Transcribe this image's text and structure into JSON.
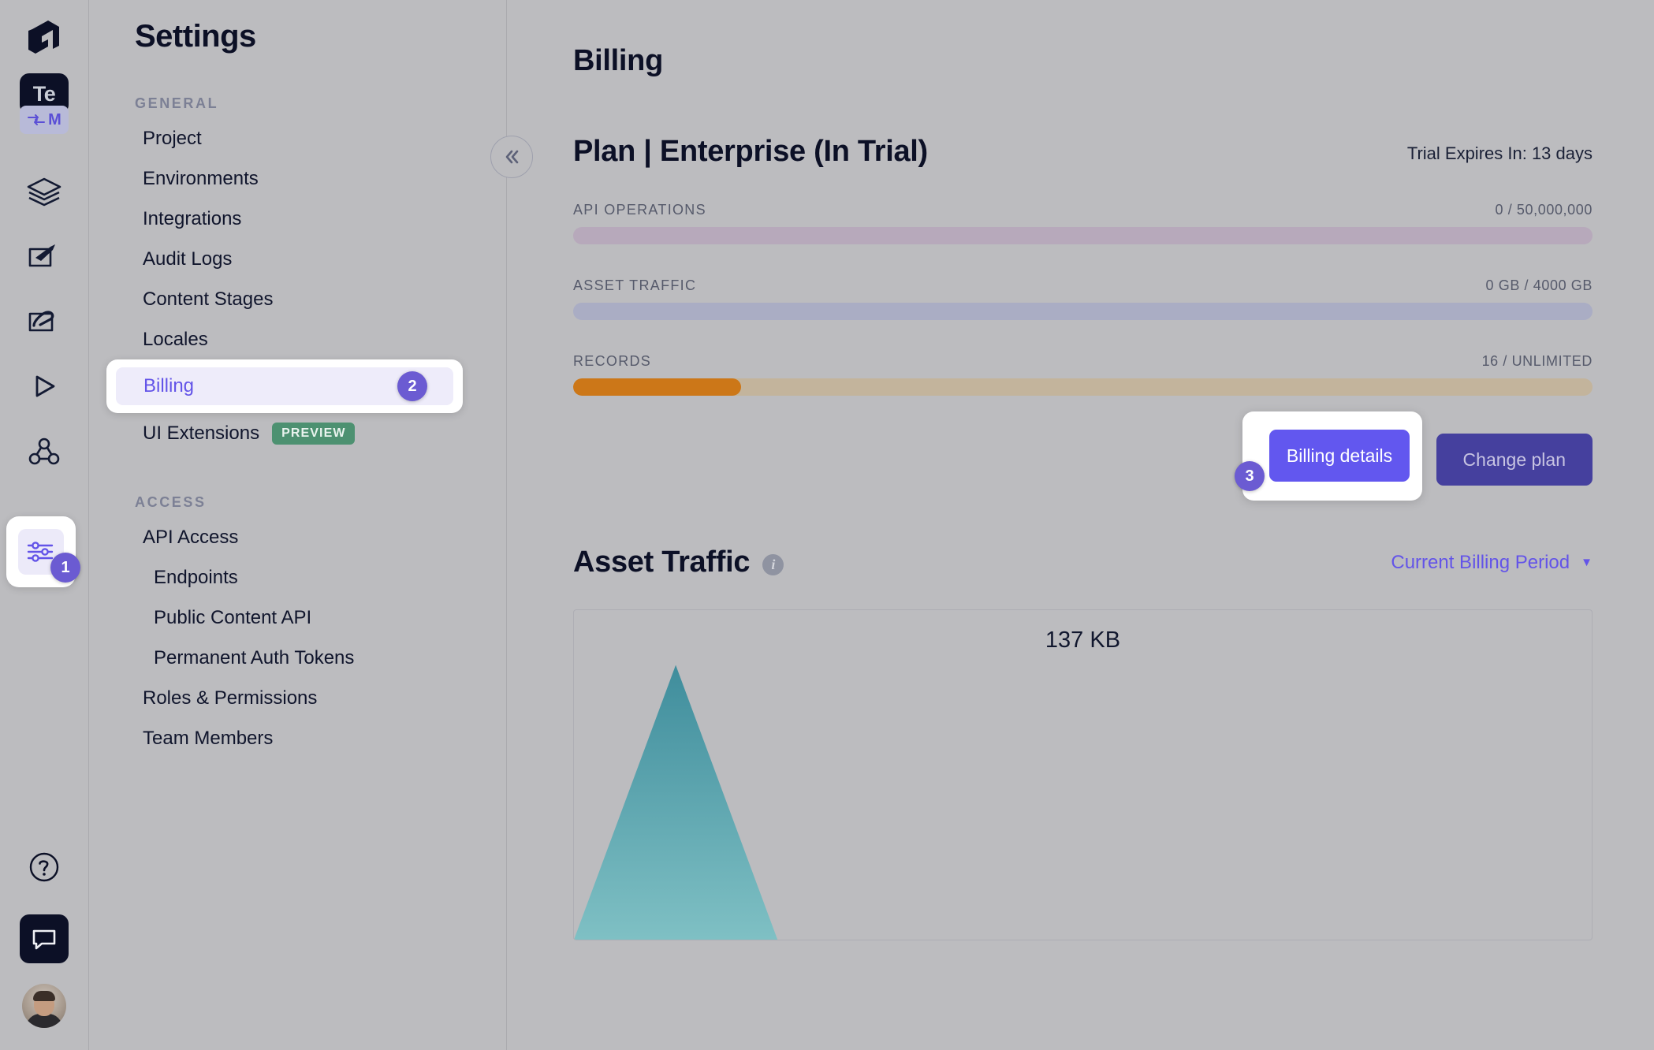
{
  "rail": {
    "logo_icon": "hygraph-logo-icon",
    "project_initials": "Te",
    "env_initial": "M",
    "env_icon": "environment-switch-icon",
    "icons": [
      {
        "name": "schema-stack-icon",
        "label": "Schema"
      },
      {
        "name": "content-edit-icon",
        "label": "Content"
      },
      {
        "name": "assets-edit-icon",
        "label": "Assets"
      },
      {
        "name": "api-playground-icon",
        "label": "API Playground"
      },
      {
        "name": "webhooks-icon",
        "label": "Webhooks"
      }
    ],
    "settings_icon": "settings-sliders-icon",
    "settings_step": "1",
    "help_icon": "help-question-icon",
    "chat_icon": "chat-bubble-icon",
    "avatar": "user-avatar"
  },
  "settings": {
    "title": "Settings",
    "collapse_icon": "chevron-double-left-icon",
    "groups": [
      {
        "label": "GENERAL",
        "items": [
          {
            "label": "Project",
            "sub": false
          },
          {
            "label": "Environments",
            "sub": false
          },
          {
            "label": "Integrations",
            "sub": false
          },
          {
            "label": "Audit Logs",
            "sub": false
          },
          {
            "label": "Content Stages",
            "sub": false
          },
          {
            "label": "Locales",
            "sub": false
          },
          {
            "label": "Billing",
            "sub": false,
            "active": true,
            "step": "2"
          },
          {
            "label": "UI Extensions",
            "sub": false,
            "badge": "PREVIEW"
          }
        ]
      },
      {
        "label": "ACCESS",
        "items": [
          {
            "label": "API Access",
            "sub": false
          },
          {
            "label": "Endpoints",
            "sub": true
          },
          {
            "label": "Public Content API",
            "sub": true
          },
          {
            "label": "Permanent Auth Tokens",
            "sub": true
          },
          {
            "label": "Roles & Permissions",
            "sub": false
          },
          {
            "label": "Team Members",
            "sub": false
          }
        ]
      }
    ]
  },
  "main": {
    "page_title": "Billing",
    "plan_heading": "Plan | Enterprise (In Trial)",
    "trial_text": "Trial Expires In: 13 days",
    "meters": [
      {
        "label": "API OPERATIONS",
        "value": "0 / 50,000,000",
        "percent": 0,
        "track_color": "#b7a9bb",
        "fill_color": "#b7a9bb"
      },
      {
        "label": "ASSET TRAFFIC",
        "value": "0 GB / 4000 GB",
        "percent": 0,
        "track_color": "#aaadc4",
        "fill_color": "#aaadc4"
      },
      {
        "label": "RECORDS",
        "value": "16 / UNLIMITED",
        "percent": 16.5,
        "track_color": "#c3b49c",
        "fill_color": "#cc7718"
      }
    ],
    "billing_details_label": "Billing details",
    "billing_details_step": "3",
    "change_plan_label": "Change plan",
    "asset_traffic_title": "Asset Traffic",
    "info_icon": "info-icon",
    "period_label": "Current Billing Period",
    "period_caret_icon": "chevron-down-icon"
  },
  "chart_data": {
    "type": "area",
    "title": "137 KB",
    "peak_label": "137 KB",
    "xlabel": "",
    "ylabel": "",
    "series": [
      {
        "name": "Asset Traffic",
        "color": "#4f9aa6",
        "x": [
          0,
          1,
          2,
          3,
          4,
          5,
          6,
          7,
          8,
          9,
          10
        ],
        "values": [
          0,
          137,
          0,
          0,
          0,
          0,
          0,
          0,
          0,
          0,
          0
        ]
      }
    ],
    "units": "KB",
    "grid": false,
    "legend": "none"
  },
  "colors": {
    "accent": "#6354e8",
    "accent_dark": "#45409e",
    "badge": "#6b5bd2",
    "preview_green": "#4d9171",
    "background": "#bcbcbf",
    "chart_teal": "#4f9aa6",
    "records_orange": "#cc7718"
  }
}
